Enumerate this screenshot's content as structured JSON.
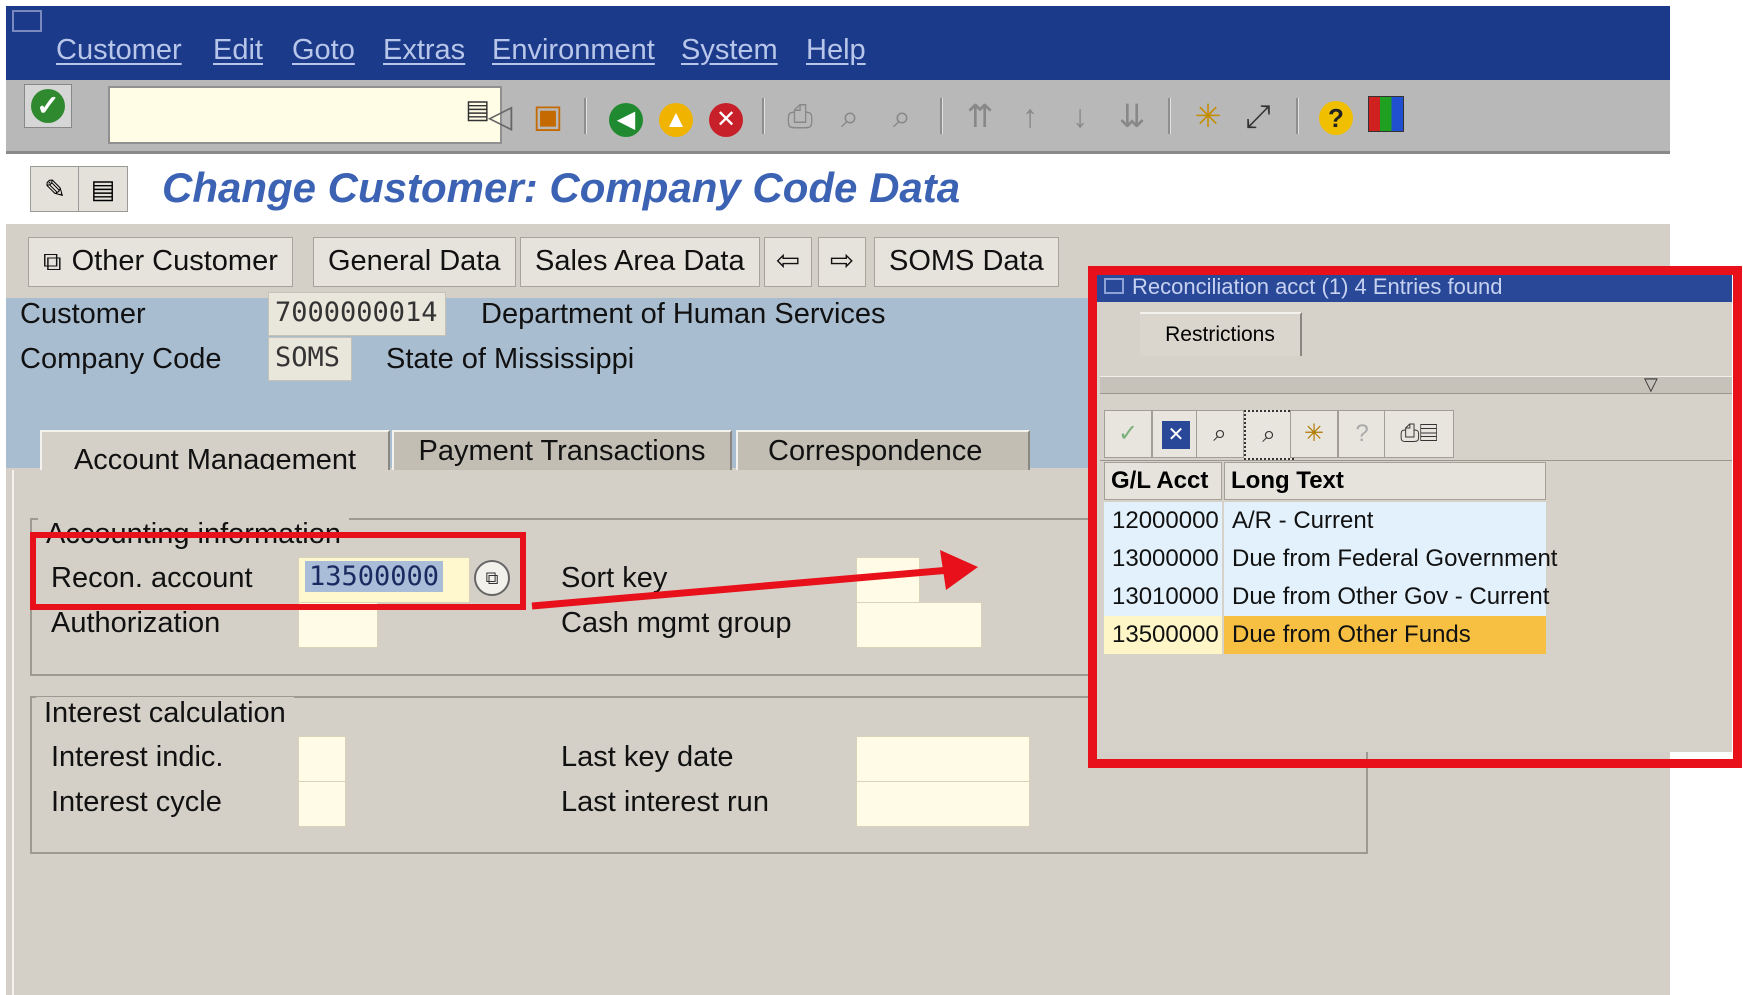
{
  "menu": [
    "Customer",
    "Edit",
    "Goto",
    "Extras",
    "Environment",
    "System",
    "Help"
  ],
  "title": "Change Customer: Company Code Data",
  "app_buttons": {
    "other_customer": "Other Customer",
    "general_data": "General Data",
    "sales_area_data": "Sales Area Data",
    "soms_data": "SOMS Data"
  },
  "header": {
    "customer_label": "Customer",
    "customer_value": "7000000014",
    "customer_name": "Department of Human Services",
    "company_code_label": "Company Code",
    "company_code_value": "SOMS",
    "company_name": "State of Mississippi"
  },
  "tabs": [
    "Account Management",
    "Payment Transactions",
    "Correspondence"
  ],
  "accounting": {
    "group_title": "Accounting information",
    "recon_label": "Recon. account",
    "recon_value": "13500000",
    "sort_key_label": "Sort key",
    "authorization_label": "Authorization",
    "cash_mgmt_label": "Cash mgmt group"
  },
  "interest": {
    "group_title": "Interest calculation",
    "indic_label": "Interest indic.",
    "cycle_label": "Interest cycle",
    "last_key_date_label": "Last key date",
    "last_run_label": "Last interest run"
  },
  "popup": {
    "title": "Reconciliation acct (1)   4 Entries found",
    "tab": "Restrictions",
    "columns": [
      "G/L Acct",
      "Long Text"
    ],
    "rows": [
      {
        "acct": "12000000",
        "text": "A/R - Current"
      },
      {
        "acct": "13000000",
        "text": "Due from Federal Government"
      },
      {
        "acct": "13010000",
        "text": "Due from Other Gov - Current"
      },
      {
        "acct": "13500000",
        "text": "Due from Other Funds"
      }
    ],
    "selected_acct": "13500000"
  },
  "colors": {
    "menu_bg": "#1c3a8a",
    "title": "#3c62b4",
    "header_bg": "#a9bdd1",
    "highlight": "#f7c042",
    "annotation": "#e8101a"
  }
}
